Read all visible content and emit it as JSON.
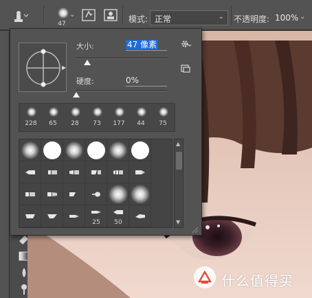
{
  "options_bar": {
    "brush_preset_size": "47",
    "mode_label": "模式:",
    "mode_value": "正常",
    "opacity_label": "不透明度:",
    "opacity_value": "100%"
  },
  "popup": {
    "size_label": "大小:",
    "size_value": "47 像素",
    "hardness_label": "硬度:",
    "hardness_value": "0%",
    "size_slider_fraction": 0.12,
    "hardness_slider_fraction": 0.0,
    "recent_brushes": [
      "228",
      "65",
      "28",
      "73",
      "177",
      "44",
      "75"
    ],
    "grid_numbers": [
      "25",
      "50"
    ]
  },
  "watermark": {
    "text": "什么值得买"
  },
  "icons": [
    "brush-tool-icon",
    "chevron-down-icon",
    "brush-panel-icon",
    "clone-source-icon",
    "gear-icon",
    "new-preset-icon",
    "eraser-icon",
    "gradient-icon",
    "blur-icon",
    "dodge-icon"
  ],
  "colors": {
    "accent": "#1e6bd6",
    "panel": "#535353"
  }
}
